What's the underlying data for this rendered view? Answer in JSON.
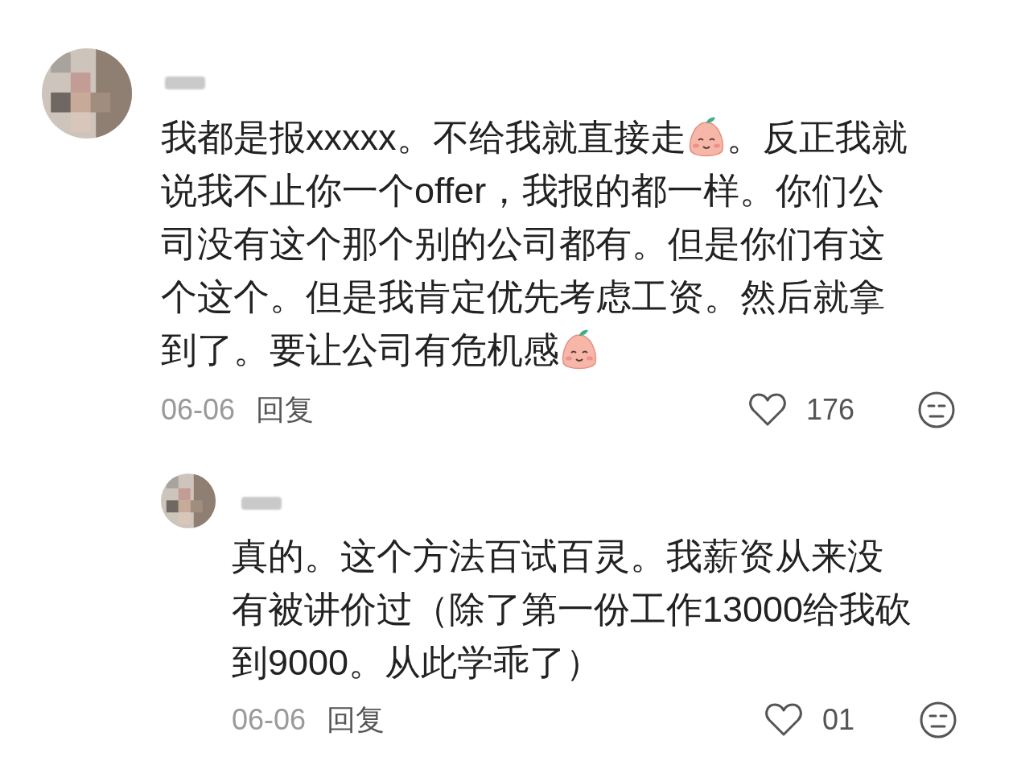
{
  "comments": [
    {
      "kind": "top",
      "lines": [
        [
          {
            "kind": "text",
            "text": "我都是报xxxxx。不给我就直接走"
          },
          {
            "kind": "emoji"
          },
          {
            "kind": "text",
            "text": "。反正我就"
          }
        ],
        [
          {
            "kind": "text",
            "text": "说我不止你一个offer，我报的都一样。你们公"
          }
        ],
        [
          {
            "kind": "text",
            "text": "司没有这个那个别的公司都有。但是你们有这"
          }
        ],
        [
          {
            "kind": "text",
            "text": "个这个。但是我肯定优先考虑工资。然后就拿"
          }
        ],
        [
          {
            "kind": "text",
            "text": "到了。要让公司有危机感"
          },
          {
            "kind": "emoji"
          }
        ]
      ],
      "date": "06-06",
      "reply": "回复",
      "likes": "176"
    },
    {
      "kind": "reply",
      "lines": [
        [
          {
            "kind": "text",
            "text": "真的。这个方法百试百灵。我薪资从来没"
          }
        ],
        [
          {
            "kind": "text",
            "text": "有被讲价过（除了第一份工作13000给我砍"
          }
        ],
        [
          {
            "kind": "text",
            "text": "到9000。从此学乖了）"
          }
        ]
      ],
      "date": "06-06",
      "reply": "回复",
      "likes": "01"
    }
  ]
}
